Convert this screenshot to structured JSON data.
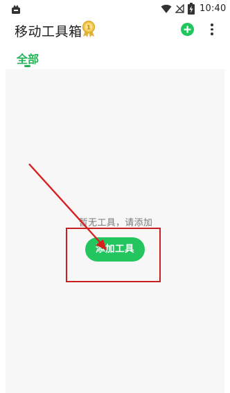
{
  "status_bar": {
    "time": "10:40",
    "icons": [
      "app-notification-icon",
      "wifi-icon",
      "signal-off-icon",
      "battery-charging-icon"
    ]
  },
  "header": {
    "title": "移动工具箱",
    "medal_icon": "medal-icon",
    "add_icon": "plus-circle-icon",
    "more_icon": "more-vert-icon"
  },
  "tabs": [
    {
      "label": "全部",
      "active": true
    }
  ],
  "empty_state": {
    "message": "暂无工具，请添加",
    "button_label": "添加工具"
  },
  "colors": {
    "accent": "#23c55f",
    "tab_active": "#21b356",
    "panel_bg": "#f7f7f8",
    "annotation_red": "#c81e1e"
  }
}
